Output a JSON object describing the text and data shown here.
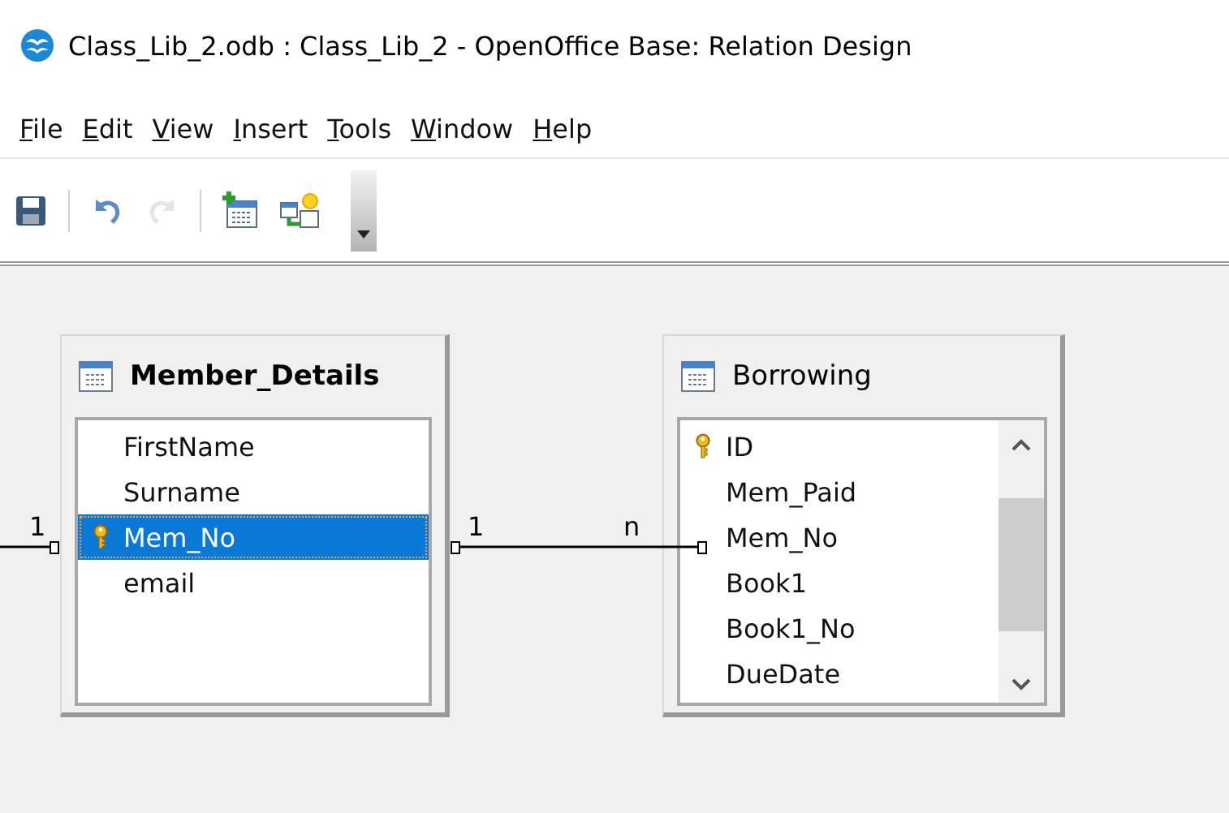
{
  "window": {
    "title": "Class_Lib_2.odb : Class_Lib_2 - OpenOffice Base: Relation Design"
  },
  "menu": [
    "File",
    "Edit",
    "View",
    "Insert",
    "Tools",
    "Window",
    "Help"
  ],
  "toolbar": [
    {
      "kind": "save",
      "disabled": false
    },
    {
      "kind": "sep"
    },
    {
      "kind": "undo",
      "disabled": false
    },
    {
      "kind": "redo",
      "disabled": true
    },
    {
      "kind": "sep"
    },
    {
      "kind": "add-table",
      "disabled": false
    },
    {
      "kind": "new-relation",
      "disabled": false
    },
    {
      "kind": "more"
    }
  ],
  "tables": [
    {
      "title": "Member_Details",
      "bold": true,
      "scrollbar": false,
      "fields": [
        {
          "name": "FirstName",
          "primary_key": false,
          "selected": false
        },
        {
          "name": "Surname",
          "primary_key": false,
          "selected": false
        },
        {
          "name": "Mem_No",
          "primary_key": true,
          "selected": true
        },
        {
          "name": "email",
          "primary_key": false,
          "selected": false
        }
      ]
    },
    {
      "title": "Borrowing",
      "bold": false,
      "scrollbar": true,
      "fields": [
        {
          "name": "ID",
          "primary_key": true,
          "selected": false
        },
        {
          "name": "Mem_Paid",
          "primary_key": false,
          "selected": false
        },
        {
          "name": "Mem_No",
          "primary_key": false,
          "selected": false
        },
        {
          "name": "Book1",
          "primary_key": false,
          "selected": false
        },
        {
          "name": "Book1_No",
          "primary_key": false,
          "selected": false
        },
        {
          "name": "DueDate",
          "primary_key": false,
          "selected": false
        }
      ]
    }
  ],
  "relations": [
    {
      "member_end": "1"
    },
    {
      "member_end": "1",
      "borrowing_end": "n"
    }
  ]
}
